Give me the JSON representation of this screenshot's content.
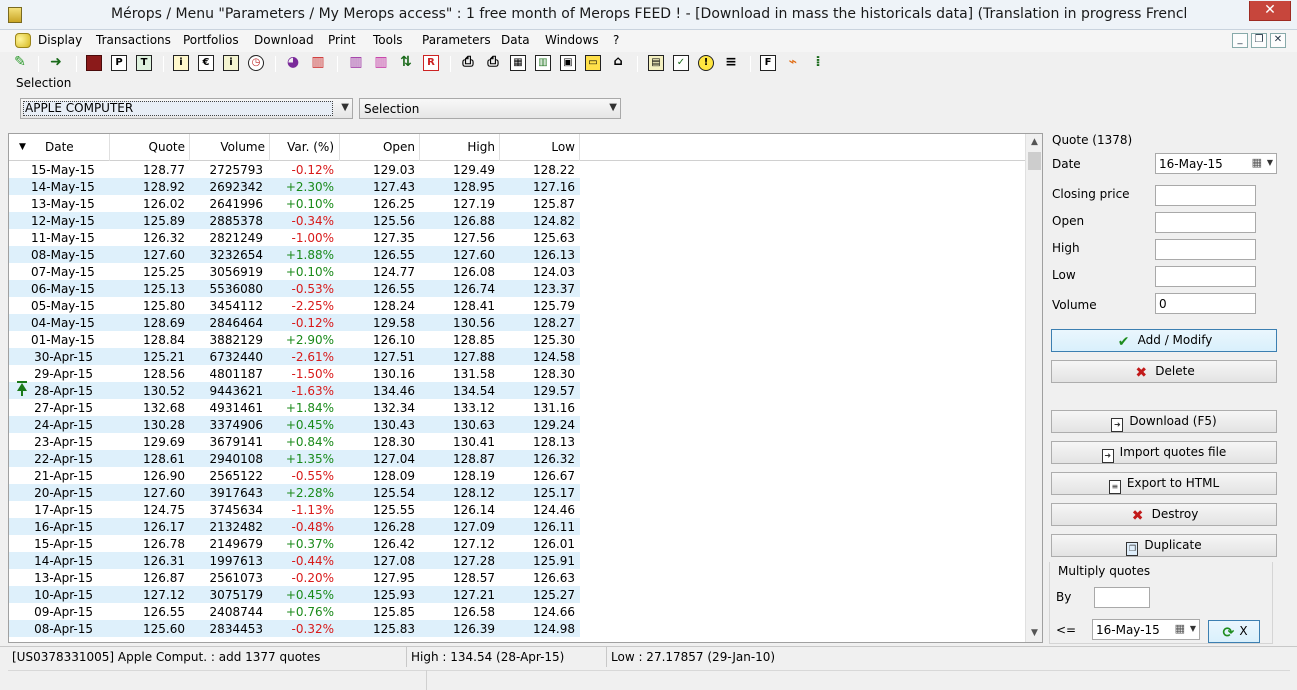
{
  "window": {
    "title": "Mérops / Menu \"Parameters / My Merops access\" : 1 free month of Merops FEED ! - [Download in mass the historicals data] (Translation in progress French -> Engl",
    "close_glyph": "✕"
  },
  "menu": [
    "Display",
    "Transactions",
    "Portfolios",
    "Download",
    "Print",
    "Tools",
    "Parameters",
    "Data",
    "Windows",
    "?"
  ],
  "toolbar_icons": [
    {
      "name": "wand-icon",
      "glyph": ""
    },
    {
      "name": "go-arrow-icon",
      "glyph": "➜"
    },
    {
      "name": "book-icon",
      "glyph": ""
    },
    {
      "name": "p-icon",
      "glyph": "P"
    },
    {
      "name": "t-icon",
      "glyph": "T"
    },
    {
      "name": "info-icon",
      "glyph": "i"
    },
    {
      "name": "euro-icon",
      "glyph": "€"
    },
    {
      "name": "info-doc-icon",
      "glyph": "i"
    },
    {
      "name": "clock-icon",
      "glyph": "◷"
    },
    {
      "name": "pie-chart-icon",
      "glyph": "◕"
    },
    {
      "name": "bar-chart-icon",
      "glyph": "▥"
    },
    {
      "name": "candle-chart-icon",
      "glyph": "▥"
    },
    {
      "name": "candle-chart-2-icon",
      "glyph": "▥"
    },
    {
      "name": "up-down-icon",
      "glyph": "⇅"
    },
    {
      "name": "r-icon",
      "glyph": "R"
    },
    {
      "name": "print-icon",
      "glyph": "⎙"
    },
    {
      "name": "print-preview-icon",
      "glyph": "⎙"
    },
    {
      "name": "table-icon",
      "glyph": "▦"
    },
    {
      "name": "columns-icon",
      "glyph": "▥"
    },
    {
      "name": "image-icon",
      "glyph": "▣"
    },
    {
      "name": "battery-icon",
      "glyph": "▭"
    },
    {
      "name": "tray-icon",
      "glyph": "⌂"
    },
    {
      "name": "calculator-icon",
      "glyph": "▤"
    },
    {
      "name": "checklist-icon",
      "glyph": "✓"
    },
    {
      "name": "warning-icon",
      "glyph": "!"
    },
    {
      "name": "list-icon",
      "glyph": "≡"
    },
    {
      "name": "f-icon",
      "glyph": "F"
    },
    {
      "name": "rss-icon",
      "glyph": "⌁"
    },
    {
      "name": "dots-icon",
      "glyph": "⁞"
    }
  ],
  "selection": {
    "label": "Selection",
    "stock": "APPLE COMPUTER",
    "list": "Selection"
  },
  "table": {
    "columns": [
      "Date",
      "Quote",
      "Volume",
      "Var. (%)",
      "Open",
      "High",
      "Low"
    ],
    "rows": [
      {
        "date": "15-May-15",
        "quote": "128.77",
        "volume": "2725793",
        "var": "-0.12%",
        "open": "129.03",
        "high": "129.49",
        "low": "128.22"
      },
      {
        "date": "14-May-15",
        "quote": "128.92",
        "volume": "2692342",
        "var": "+2.30%",
        "open": "127.43",
        "high": "128.95",
        "low": "127.16"
      },
      {
        "date": "13-May-15",
        "quote": "126.02",
        "volume": "2641996",
        "var": "+0.10%",
        "open": "126.25",
        "high": "127.19",
        "low": "125.87"
      },
      {
        "date": "12-May-15",
        "quote": "125.89",
        "volume": "2885378",
        "var": "-0.34%",
        "open": "125.56",
        "high": "126.88",
        "low": "124.82"
      },
      {
        "date": "11-May-15",
        "quote": "126.32",
        "volume": "2821249",
        "var": "-1.00%",
        "open": "127.35",
        "high": "127.56",
        "low": "125.63"
      },
      {
        "date": "08-May-15",
        "quote": "127.60",
        "volume": "3232654",
        "var": "+1.88%",
        "open": "126.55",
        "high": "127.60",
        "low": "126.13"
      },
      {
        "date": "07-May-15",
        "quote": "125.25",
        "volume": "3056919",
        "var": "+0.10%",
        "open": "124.77",
        "high": "126.08",
        "low": "124.03"
      },
      {
        "date": "06-May-15",
        "quote": "125.13",
        "volume": "5536080",
        "var": "-0.53%",
        "open": "126.55",
        "high": "126.74",
        "low": "123.37"
      },
      {
        "date": "05-May-15",
        "quote": "125.80",
        "volume": "3454112",
        "var": "-2.25%",
        "open": "128.24",
        "high": "128.41",
        "low": "125.79"
      },
      {
        "date": "04-May-15",
        "quote": "128.69",
        "volume": "2846464",
        "var": "-0.12%",
        "open": "129.58",
        "high": "130.56",
        "low": "128.27"
      },
      {
        "date": "01-May-15",
        "quote": "128.84",
        "volume": "3882129",
        "var": "+2.90%",
        "open": "126.10",
        "high": "128.85",
        "low": "125.30"
      },
      {
        "date": "30-Apr-15",
        "quote": "125.21",
        "volume": "6732440",
        "var": "-2.61%",
        "open": "127.51",
        "high": "127.88",
        "low": "124.58"
      },
      {
        "date": "29-Apr-15",
        "quote": "128.56",
        "volume": "4801187",
        "var": "-1.50%",
        "open": "130.16",
        "high": "131.58",
        "low": "128.30"
      },
      {
        "date": "28-Apr-15",
        "quote": "130.52",
        "volume": "9443621",
        "var": "-1.63%",
        "open": "134.46",
        "high": "134.54",
        "low": "129.57",
        "marked": true
      },
      {
        "date": "27-Apr-15",
        "quote": "132.68",
        "volume": "4931461",
        "var": "+1.84%",
        "open": "132.34",
        "high": "133.12",
        "low": "131.16"
      },
      {
        "date": "24-Apr-15",
        "quote": "130.28",
        "volume": "3374906",
        "var": "+0.45%",
        "open": "130.43",
        "high": "130.63",
        "low": "129.24"
      },
      {
        "date": "23-Apr-15",
        "quote": "129.69",
        "volume": "3679141",
        "var": "+0.84%",
        "open": "128.30",
        "high": "130.41",
        "low": "128.13"
      },
      {
        "date": "22-Apr-15",
        "quote": "128.61",
        "volume": "2940108",
        "var": "+1.35%",
        "open": "127.04",
        "high": "128.87",
        "low": "126.32"
      },
      {
        "date": "21-Apr-15",
        "quote": "126.90",
        "volume": "2565122",
        "var": "-0.55%",
        "open": "128.09",
        "high": "128.19",
        "low": "126.67"
      },
      {
        "date": "20-Apr-15",
        "quote": "127.60",
        "volume": "3917643",
        "var": "+2.28%",
        "open": "125.54",
        "high": "128.12",
        "low": "125.17"
      },
      {
        "date": "17-Apr-15",
        "quote": "124.75",
        "volume": "3745634",
        "var": "-1.13%",
        "open": "125.55",
        "high": "126.14",
        "low": "124.46"
      },
      {
        "date": "16-Apr-15",
        "quote": "126.17",
        "volume": "2132482",
        "var": "-0.48%",
        "open": "126.28",
        "high": "127.09",
        "low": "126.11"
      },
      {
        "date": "15-Apr-15",
        "quote": "126.78",
        "volume": "2149679",
        "var": "+0.37%",
        "open": "126.42",
        "high": "127.12",
        "low": "126.01"
      },
      {
        "date": "14-Apr-15",
        "quote": "126.31",
        "volume": "1997613",
        "var": "-0.44%",
        "open": "127.08",
        "high": "127.28",
        "low": "125.91"
      },
      {
        "date": "13-Apr-15",
        "quote": "126.87",
        "volume": "2561073",
        "var": "-0.20%",
        "open": "127.95",
        "high": "128.57",
        "low": "126.63"
      },
      {
        "date": "10-Apr-15",
        "quote": "127.12",
        "volume": "3075179",
        "var": "+0.45%",
        "open": "125.93",
        "high": "127.21",
        "low": "125.27"
      },
      {
        "date": "09-Apr-15",
        "quote": "126.55",
        "volume": "2408744",
        "var": "+0.76%",
        "open": "125.85",
        "high": "126.58",
        "low": "124.66"
      },
      {
        "date": "08-Apr-15",
        "quote": "125.60",
        "volume": "2834453",
        "var": "-0.32%",
        "open": "125.83",
        "high": "126.39",
        "low": "124.98"
      }
    ]
  },
  "quote_panel": {
    "group_title": "Quote (1378)",
    "date_label": "Date",
    "date_value": "16-May-15",
    "closing_label": "Closing price",
    "closing_value": "",
    "open_label": "Open",
    "open_value": "",
    "high_label": "High",
    "high_value": "",
    "low_label": "Low",
    "low_value": "",
    "volume_label": "Volume",
    "volume_value": "0",
    "add_modify": "Add / Modify",
    "delete": "Delete",
    "download": "Download (F5)",
    "import": "Import quotes file",
    "export": "Export to HTML",
    "destroy": "Destroy",
    "duplicate": "Duplicate",
    "multiply_title": "Multiply quotes",
    "by_label": "By",
    "by_value": "",
    "le_label": "<=",
    "le_date": "16-May-15",
    "apply_x": "X"
  },
  "status": {
    "left": "[US0378331005] Apple Comput. : add 1377 quotes",
    "high": "High : 134.54 (28-Apr-15)",
    "low": "Low : 27.17857 (29-Jan-10)"
  },
  "colors": {
    "positive": "#1a8a1a",
    "negative": "#d81a1a",
    "alt_row": "#def0fb",
    "accent": "#3c7fb1"
  }
}
